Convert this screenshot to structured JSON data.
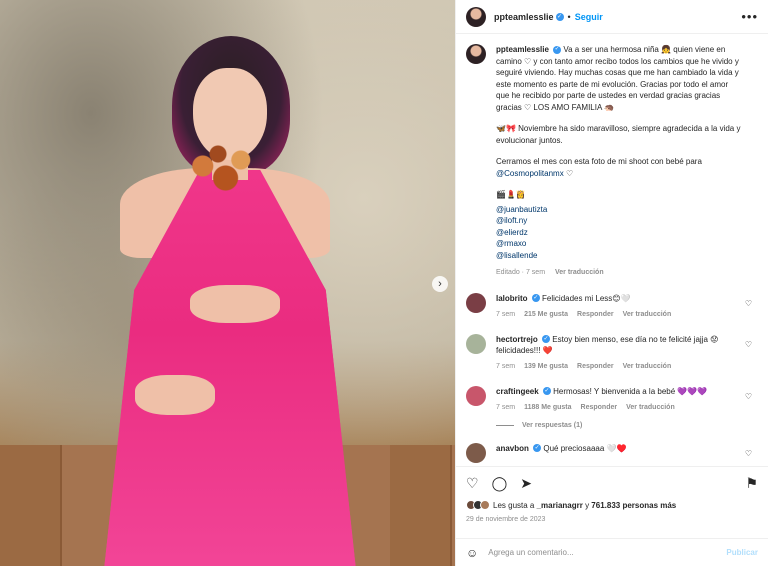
{
  "post": {
    "username": "ppteamlesslie",
    "follow_label": "Seguir",
    "more_icon": "more-icon",
    "colors": {
      "accent": "#0095f6",
      "muted": "#8e8e8e",
      "link": "#00376b",
      "dress": "#ef3388"
    }
  },
  "caption": {
    "username": "ppteamlesslie",
    "p1": "Va a ser una hermosa niña 👧 quien viene en camino ♡ y con tanto amor recibo todos los cambios que he vivido y seguiré viviendo. Hay muchas cosas que me han cambiado la vida y este momento es parte de mi evolución. Gracias por todo el amor que he recibido por parte de ustedes en verdad gracias gracias gracias ♡ LOS AMO FAMILIA 🦔",
    "p2": "🦋🎀 Noviembre ha sido maravilloso, siempre agradecida a la vida y evolucionar juntos.",
    "p3": "Cerramos el mes con esta foto de mi shoot con bebé para",
    "p3_link": "@Cosmopolitanmx",
    "p3_heart": "♡",
    "emojis": "🎬💄👸",
    "credits": [
      "@juanbautizta",
      "@iloft.ny",
      "@elierdz",
      "@rmaxo",
      "@lisallende"
    ],
    "edited": "Editado · 7 sem",
    "translate": "Ver traducción"
  },
  "comments": [
    {
      "user": "lalobrito",
      "text": "Felicidades mi Less😊🤍",
      "age": "7 sem",
      "likes": "215 Me gusta",
      "reply": "Responder",
      "translate": "Ver traducción",
      "avatar_color": "#7a3e45"
    },
    {
      "user": "hectortrejo",
      "text": "Estoy bien menso, ese día no te felicité jajja 😟 felicidades!!! ❤️",
      "age": "7 sem",
      "likes": "139 Me gusta",
      "reply": "Responder",
      "translate": "Ver traducción",
      "avatar_color": "#a7b39a"
    },
    {
      "user": "craftingeek",
      "text": "Hermosas! Y bienvenida a la bebé 💜💜💜",
      "age": "7 sem",
      "likes": "1188 Me gusta",
      "reply": "Responder",
      "translate": "Ver traducción",
      "avatar_color": "#c8566b"
    },
    {
      "user": "anavbon",
      "text": "Qué preciosaaaa 🤍♥️",
      "avatar_color": "#7d5b4a"
    }
  ],
  "view_replies": "Ver respuestas (1)",
  "likes_line": {
    "prefix": "Les gusta a ",
    "user": "_marianagrr",
    "middle": " y ",
    "count": "761.833",
    "suffix": " personas más"
  },
  "date": "29 de noviembre de 2023",
  "add_comment": {
    "placeholder": "Agrega un comentario...",
    "post_label": "Publicar"
  },
  "carousel": {
    "slides": 4,
    "active": 1
  }
}
